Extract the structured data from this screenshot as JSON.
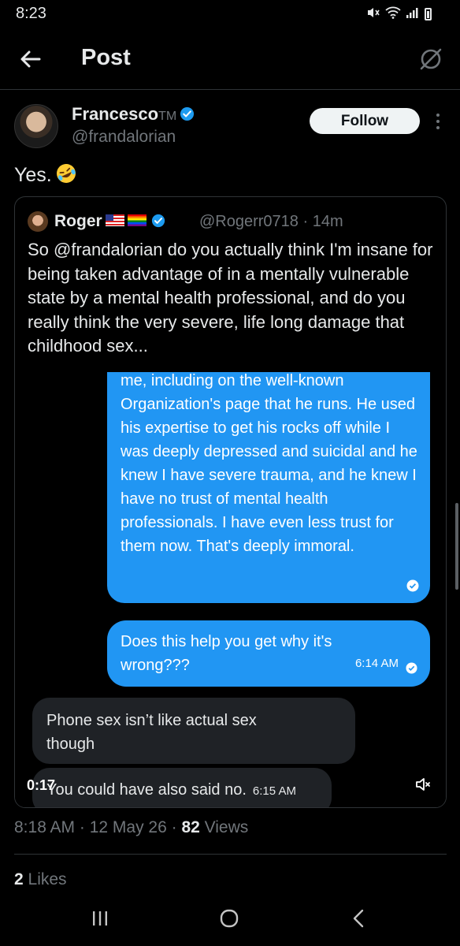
{
  "status_bar": {
    "time": "8:23"
  },
  "header": {
    "title": "Post"
  },
  "author": {
    "name": "Francesco",
    "suffix": "TM",
    "handle": "@frandalorian",
    "follow_label": "Follow"
  },
  "post": {
    "text": "Yes.",
    "timestamp": "8:18 AM · 12 May 26 · ",
    "views_count": "82",
    "views_label": " Views",
    "likes_count": "2",
    "likes_label": " Likes"
  },
  "quote": {
    "name": "Roger",
    "handle_time": "@Rogerr0718 · 14m",
    "text": "So @frandalorian do you actually  think I'm insane for being taken advantage of in a mentally vulnerable state by a mental health professional, and do you really think the very severe, life long damage that childhood sex..."
  },
  "media": {
    "bubble1": "me, including on the well-known Organization's page that he runs. He used his expertise to get his rocks off while I was deeply depressed and suicidal and he knew I have severe trauma, and he knew I have no trust of mental health professionals.  I have even less trust for them now. That's deeply immoral.",
    "bubble2_text": "Does this help you get why it's wrong???",
    "bubble2_time": "6:14 AM",
    "gray1": "Phone sex isn’t like actual sex though",
    "gray2_text": "You could have also said no.",
    "gray2_time": "6:15 AM",
    "duration": "0:17"
  },
  "colors": {
    "accent": "#1d9bf0",
    "bubble_blue": "#2196f3",
    "bubble_gray": "#1f2226"
  }
}
